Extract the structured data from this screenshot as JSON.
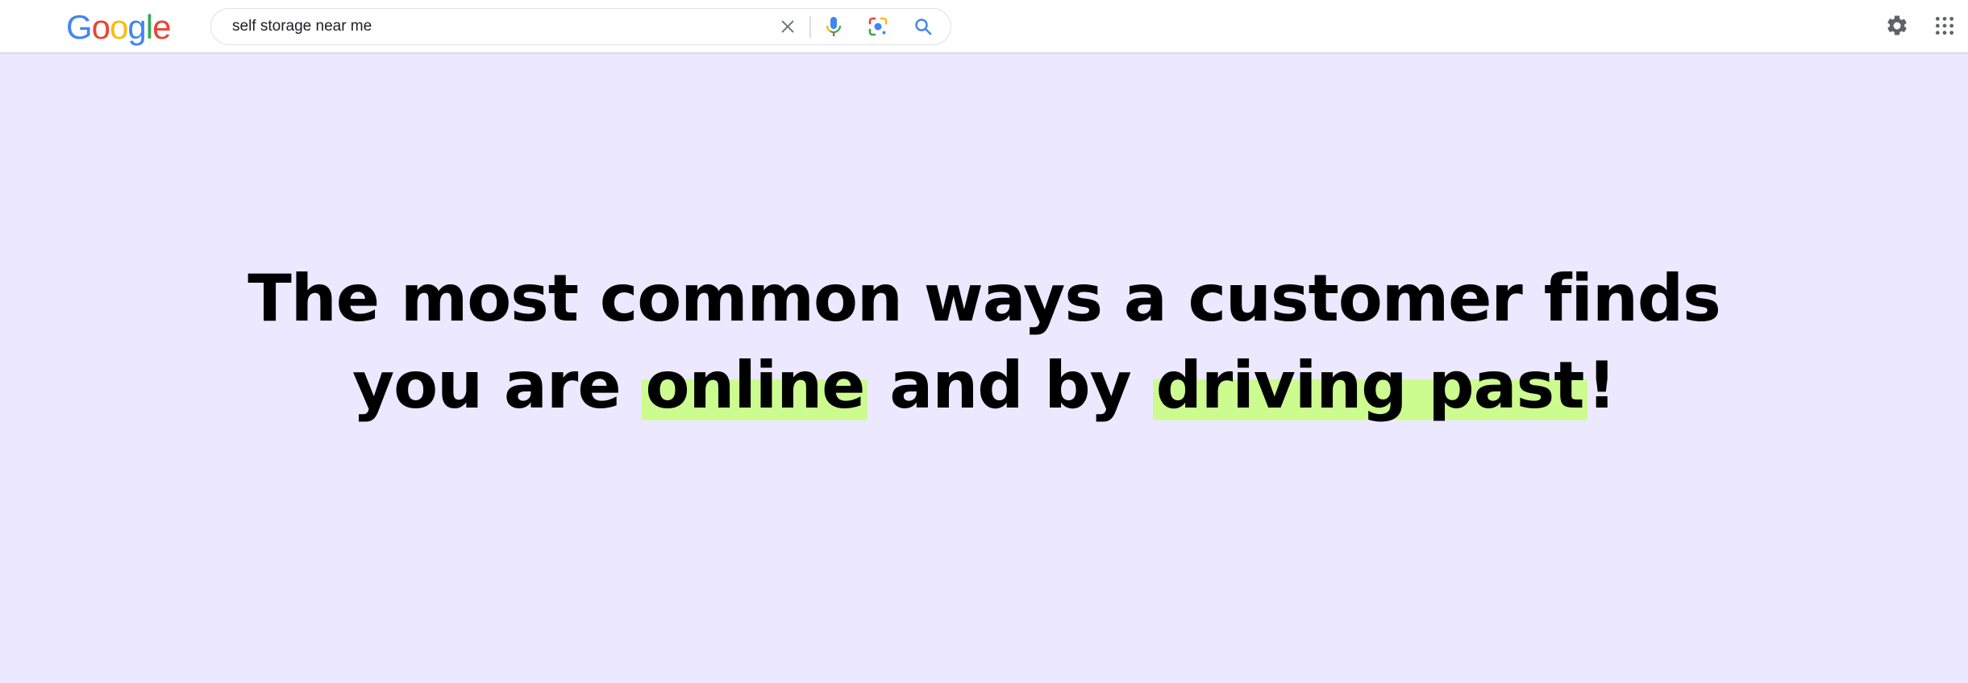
{
  "header": {
    "logo": {
      "letters": [
        {
          "char": "G",
          "color": "#4285F4"
        },
        {
          "char": "o",
          "color": "#EA4335"
        },
        {
          "char": "o",
          "color": "#FBBC05"
        },
        {
          "char": "g",
          "color": "#4285F4"
        },
        {
          "char": "l",
          "color": "#34A853"
        },
        {
          "char": "e",
          "color": "#EA4335"
        }
      ]
    },
    "search": {
      "value": "self storage near me",
      "icons": [
        "close-icon",
        "microphone-icon",
        "lens-icon",
        "search-icon"
      ]
    },
    "right_icons": [
      "gear-icon",
      "apps-grid-icon"
    ]
  },
  "hero": {
    "background_color": "#ebe8ff",
    "highlight_color": "#ccfc8f",
    "line1": "The most common ways a customer finds",
    "line2_part1": "you are ",
    "line2_highlight1": "online",
    "line2_part2": " and by ",
    "line2_highlight2": "driving past",
    "line2_part3": "!"
  }
}
